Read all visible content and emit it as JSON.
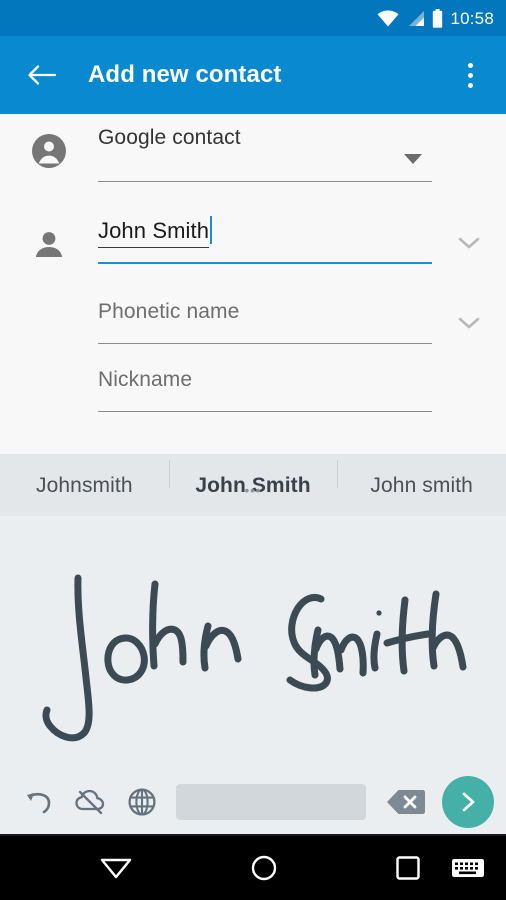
{
  "status_bar": {
    "time": "10:58",
    "icons": [
      "wifi-icon",
      "cellular-signal-icon",
      "battery-icon"
    ],
    "background": "#0277BD"
  },
  "app_bar": {
    "back_icon": "arrow-back-icon",
    "title": "Add new contact",
    "overflow_icon": "overflow-menu-icon",
    "background": "#0889D0"
  },
  "form": {
    "account_row": {
      "icon": "account-circle-icon",
      "value": "Google contact",
      "dropdown_icon": "dropdown-caret-icon"
    },
    "name_row": {
      "icon": "person-icon",
      "value": "John Smith",
      "expand_icon": "chevron-down-icon",
      "focus_color": "#1A8FD8"
    },
    "phonetic_row": {
      "placeholder": "Phonetic name",
      "expand_icon": "chevron-down-icon"
    },
    "nickname_row": {
      "placeholder": "Nickname"
    }
  },
  "suggestions": {
    "items": [
      {
        "label": "Johnsmith",
        "selected": false
      },
      {
        "label": "John Smith",
        "selected": true
      },
      {
        "label": "John smith",
        "selected": false
      }
    ],
    "more_indicator": "•••",
    "background": "#E3E7EA"
  },
  "handwriting": {
    "recognized_text": "John Smith",
    "ink_color": "#3C4A54",
    "background": "#EAEEF1"
  },
  "keyboard_toolbar": {
    "undo_icon": "undo-icon",
    "cloud_off_icon": "cloud-off-icon",
    "language_icon": "globe-icon",
    "space_key": "space-key",
    "backspace_icon": "backspace-icon",
    "send_icon": "chevron-right-icon",
    "send_color": "#45B0A8"
  },
  "nav_bar": {
    "back_icon": "nav-back-triangle-icon",
    "home_icon": "nav-home-circle-icon",
    "recents_icon": "nav-recents-square-icon",
    "keyboard_icon": "nav-keyboard-icon",
    "background": "#000000"
  }
}
